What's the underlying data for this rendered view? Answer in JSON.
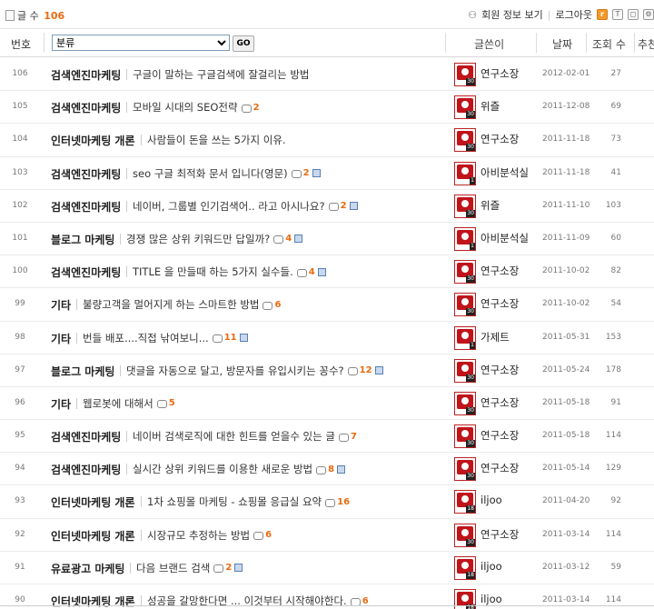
{
  "topbar": {
    "count_label": "글 수",
    "count_value": "106",
    "member_info": "회원 정보 보기",
    "logout": "로그아웃"
  },
  "header": {
    "num": "번호",
    "category_placeholder": "분류",
    "go": "GO",
    "writer": "글쓴이",
    "date": "날짜",
    "views": "조회 수",
    "recommend": "추천"
  },
  "posts": [
    {
      "num": "106",
      "category": "검색엔진마케팅",
      "title": "구글이 말하는 구글검색에 잘걸리는 방법",
      "comments": "",
      "file": false,
      "writer": "연구소장",
      "avatar_level": "30",
      "date": "2012-02-01",
      "views": "27"
    },
    {
      "num": "105",
      "category": "검색엔진마케팅",
      "title": "모바일 시대의 SEO전략",
      "comments": "2",
      "file": false,
      "writer": "위즐",
      "avatar_level": "30",
      "date": "2011-12-08",
      "views": "69"
    },
    {
      "num": "104",
      "category": "인터넷마케팅 개론",
      "title": "사람들이 돈을 쓰는 5가지 이유.",
      "comments": "",
      "file": false,
      "writer": "연구소장",
      "avatar_level": "30",
      "date": "2011-11-18",
      "views": "73"
    },
    {
      "num": "103",
      "category": "검색엔진마케팅",
      "title": "seo 구글 최적화 문서 입니다(영문)",
      "comments": "2",
      "file": true,
      "writer": "아비분석실",
      "avatar_level": "1",
      "date": "2011-11-18",
      "views": "41"
    },
    {
      "num": "102",
      "category": "검색엔진마케팅",
      "title": "네이버, 그룹별 인기검색어.. 라고 아시나요?",
      "comments": "2",
      "file": true,
      "writer": "위즐",
      "avatar_level": "30",
      "date": "2011-11-10",
      "views": "103"
    },
    {
      "num": "101",
      "category": "블로그 마케팅",
      "title": "경쟁 많은 상위 키워드만 답일까?",
      "comments": "4",
      "file": true,
      "writer": "아비분석실",
      "avatar_level": "1",
      "date": "2011-11-09",
      "views": "60"
    },
    {
      "num": "100",
      "category": "검색엔진마케팅",
      "title": "TITLE 을 만들때 하는 5가지 실수들.",
      "comments": "4",
      "file": true,
      "writer": "연구소장",
      "avatar_level": "30",
      "date": "2011-10-02",
      "views": "82"
    },
    {
      "num": "99",
      "category": "기타",
      "title": "불량고객을 멀어지게 하는 스마트한 방법",
      "comments": "6",
      "file": false,
      "writer": "연구소장",
      "avatar_level": "30",
      "date": "2011-10-02",
      "views": "54"
    },
    {
      "num": "98",
      "category": "기타",
      "title": "번들 배포....직접 낚여보니...",
      "comments": "11",
      "file": true,
      "writer": "가제트",
      "avatar_level": "1",
      "date": "2011-05-31",
      "views": "153"
    },
    {
      "num": "97",
      "category": "블로그 마케팅",
      "title": "댓글을 자동으로 달고, 방문자를 유입시키는 꽁수?",
      "comments": "12",
      "file": true,
      "writer": "연구소장",
      "avatar_level": "30",
      "date": "2011-05-24",
      "views": "178"
    },
    {
      "num": "96",
      "category": "기타",
      "title": "웹로봇에 대해서",
      "comments": "5",
      "file": false,
      "writer": "연구소장",
      "avatar_level": "30",
      "date": "2011-05-18",
      "views": "91"
    },
    {
      "num": "95",
      "category": "검색엔진마케팅",
      "title": "네이버 검색로직에 대한 힌트를 얻을수 있는 글",
      "comments": "7",
      "file": false,
      "writer": "연구소장",
      "avatar_level": "30",
      "date": "2011-05-18",
      "views": "114"
    },
    {
      "num": "94",
      "category": "검색엔진마케팅",
      "title": "실시간 상위 키워드를 이용한 새로운 방법",
      "comments": "8",
      "file": true,
      "writer": "연구소장",
      "avatar_level": "30",
      "date": "2011-05-14",
      "views": "129"
    },
    {
      "num": "93",
      "category": "인터넷마케팅 개론",
      "title": "1차 쇼핑몰 마케팅 - 쇼핑몰 응급실 요약",
      "comments": "16",
      "file": false,
      "writer": "iljoo",
      "avatar_level": "18",
      "date": "2011-04-20",
      "views": "92"
    },
    {
      "num": "92",
      "category": "인터넷마케팅 개론",
      "title": "시장규모 추정하는 방법",
      "comments": "6",
      "file": false,
      "writer": "연구소장",
      "avatar_level": "30",
      "date": "2011-03-14",
      "views": "114"
    },
    {
      "num": "91",
      "category": "유료광고 마케팅",
      "title": "다음 브랜드 검색",
      "comments": "2",
      "file": true,
      "writer": "iljoo",
      "avatar_level": "18",
      "date": "2011-03-12",
      "views": "59"
    },
    {
      "num": "90",
      "category": "인터넷마케팅 개론",
      "title": "성공을 갈망한다면 ... 이것부터 시작해야한다.",
      "comments": "6",
      "file": false,
      "writer": "iljoo",
      "avatar_level": "18",
      "date": "2011-03-14",
      "views": "114"
    }
  ]
}
